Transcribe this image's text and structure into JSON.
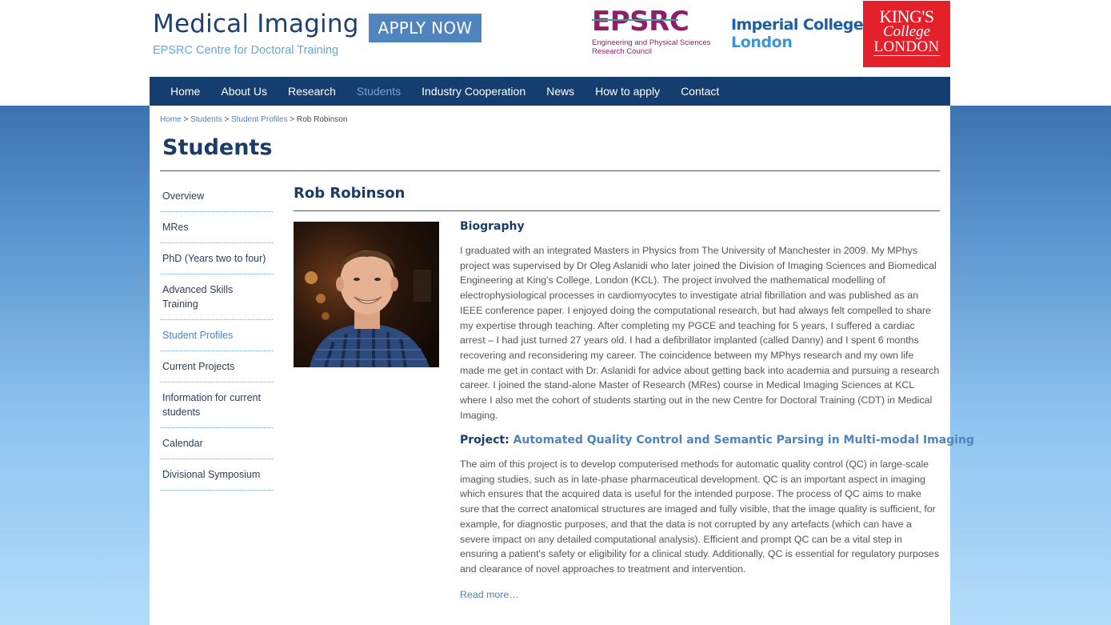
{
  "header": {
    "title": "Medical Imaging",
    "subtitle": "EPSRC Centre for Doctoral Training",
    "apply_label": "APPLY NOW"
  },
  "logos": {
    "epsrc": {
      "word": "EPSRC",
      "line1": "Engineering and Physical Sciences",
      "line2": "Research Council"
    },
    "imperial": {
      "line1": "Imperial College",
      "line2": "London"
    },
    "kcl": {
      "line1": "KING'S",
      "line2": "College",
      "line3": "LONDON"
    }
  },
  "nav": {
    "items": [
      {
        "label": "Home"
      },
      {
        "label": "About Us"
      },
      {
        "label": "Research"
      },
      {
        "label": "Students"
      },
      {
        "label": "Industry Cooperation"
      },
      {
        "label": "News"
      },
      {
        "label": "How to apply"
      },
      {
        "label": "Contact"
      }
    ],
    "active": "Students"
  },
  "breadcrumb": {
    "items": [
      "Home",
      "Students",
      "Student Profiles"
    ],
    "separator": ">",
    "current": "Rob Robinson"
  },
  "page": {
    "title": "Students"
  },
  "sidebar": {
    "items": [
      {
        "label": "Overview"
      },
      {
        "label": "MRes"
      },
      {
        "label": "PhD (Years two to four)"
      },
      {
        "label": "Advanced Skills Training"
      },
      {
        "label": "Student Profiles"
      },
      {
        "label": "Current Projects"
      },
      {
        "label": "Information for current students"
      },
      {
        "label": "Calendar"
      },
      {
        "label": "Divisional Symposium"
      }
    ],
    "active": "Student Profiles"
  },
  "profile": {
    "name": "Rob Robinson",
    "biography_heading": "Biography",
    "biography": "I graduated with an integrated Masters in Physics from The University of Manchester in 2009. My MPhys project was supervised by Dr Oleg Aslanidi who later joined the Division of Imaging Sciences and Biomedical Engineering at King's College, London (KCL). The project involved the mathematical modelling of electrophysiological processes in cardiomyocytes to investigate atrial fibrillation and was published as an IEEE conference paper. I enjoyed doing the computational research, but had always felt compelled to share my expertise through teaching. After completing my PGCE and teaching for 5 years, I suffered a cardiac arrest – I had just turned 27 years old. I had a defibrillator implanted (called Danny) and I spent 6 months recovering and reconsidering my career. The coincidence between my MPhys research and my own life made me get in contact with Dr. Aslanidi for advice about getting back into academia and pursuing a research career. I joined the stand-alone Master of Research (MRes) course in Medical Imaging Sciences at KCL where I also met the cohort of students starting out in the new Centre for Doctoral Training (CDT) in Medical Imaging.",
    "project_label": "Project:",
    "project_title": "Automated Quality Control and Semantic Parsing in Multi-modal Imaging",
    "project_text": "The aim of this project is to develop computerised methods for automatic quality control (QC) in large-scale imaging studies, such as in late-phase pharmaceutical development. QC is an important aspect in imaging which ensures that the acquired data is useful for the intended purpose. The process of QC aims to make sure that the correct anatomical structures are imaged and fully visible, that the image quality is sufficient, for example, for diagnostic purposes, and that the data is not corrupted by any artefacts (which can have a severe impact on any detailed computational analysis). Efficient and prompt QC can be a vital step in ensuring a patient's safety or eligibility for a clinical study. Additionally, QC is essential for regulatory purposes and clearance of novel approaches to treatment and intervention.",
    "read_more": "Read more…"
  },
  "colors": {
    "nav_bg": "#133e6f",
    "title": "#1e3f72",
    "accent": "#4f84bd",
    "kcl_red": "#e4202a",
    "epsrc_purple": "#8e1d6a"
  }
}
